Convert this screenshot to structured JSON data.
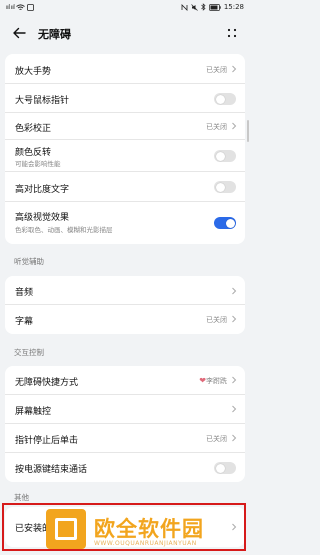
{
  "status_bar": {
    "time": "15:28",
    "carrier": "ııl ııl"
  },
  "header": {
    "title": "无障碍"
  },
  "sections": {
    "vision": [
      {
        "label": "放大手势",
        "value": "已关闭",
        "control": "chevron"
      },
      {
        "label": "大号鼠标指针",
        "control": "toggle",
        "on": false
      },
      {
        "label": "色彩校正",
        "value": "已关闭",
        "control": "chevron"
      },
      {
        "label": "颜色反转",
        "sub": "可能会影响性能",
        "control": "toggle",
        "on": false
      },
      {
        "label": "高对比度文字",
        "control": "toggle",
        "on": false
      },
      {
        "label": "高级视觉效果",
        "sub": "色彩取色、动画、模糊和光影描层",
        "control": "toggle",
        "on": true
      }
    ],
    "hearing_title": "听觉辅助",
    "hearing": [
      {
        "label": "音频",
        "control": "chevron"
      },
      {
        "label": "字幕",
        "value": "已关闭",
        "control": "chevron"
      }
    ],
    "interaction_title": "交互控制",
    "interaction": [
      {
        "label": "无障碍快捷方式",
        "value": "李跗跣",
        "control": "chevron"
      },
      {
        "label": "屏幕触控",
        "control": "chevron"
      },
      {
        "label": "指针停止后单击",
        "value": "已关闭",
        "control": "chevron"
      },
      {
        "label": "按电源键结束通话",
        "control": "toggle",
        "on": false
      }
    ],
    "other_title": "其他",
    "other": [
      {
        "label": "已安装的服务",
        "control": "chevron"
      }
    ]
  },
  "watermark": {
    "text": "欧全软件园",
    "sub": "WWW.OUQUANRUANJIANYUAN"
  },
  "colors": {
    "accent": "#2b6ae8",
    "highlight": "#d61a1a",
    "watermark": "#f2a51e"
  }
}
